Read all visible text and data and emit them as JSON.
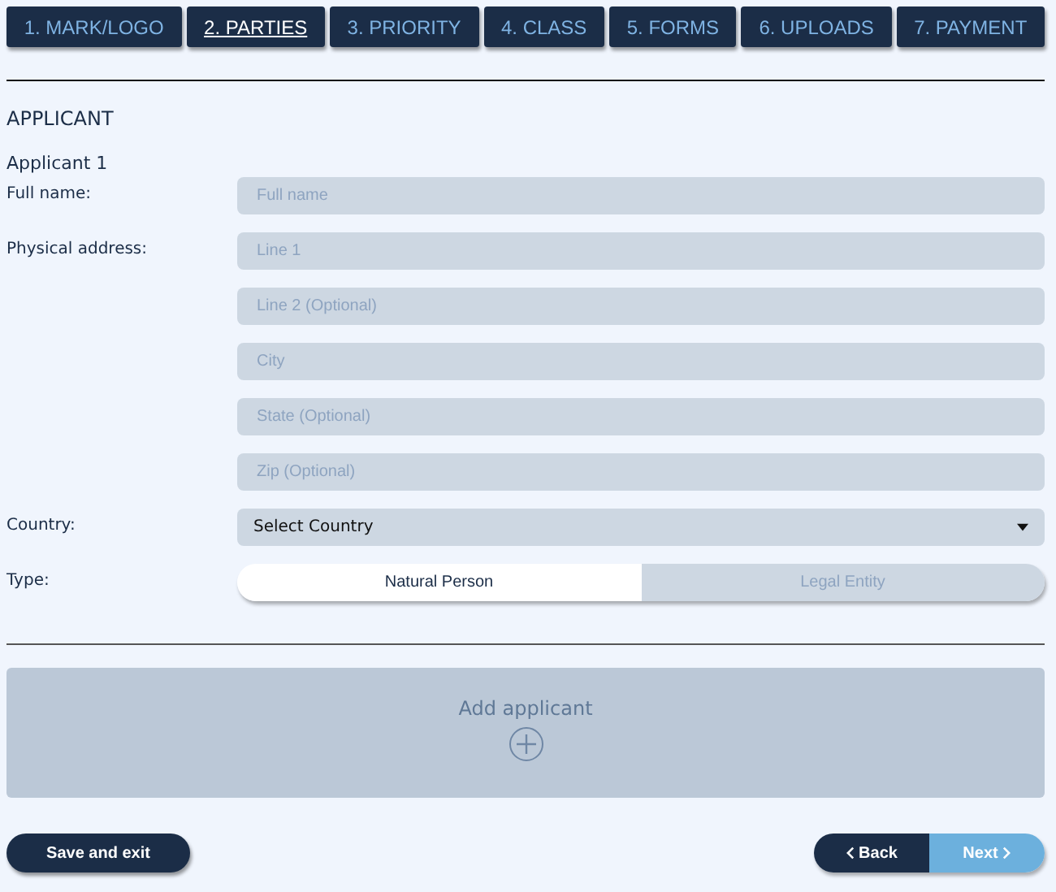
{
  "tabs": [
    {
      "label": "1. MARK/LOGO",
      "selected": false
    },
    {
      "label": "2. PARTIES",
      "selected": true
    },
    {
      "label": "3. PRIORITY",
      "selected": false
    },
    {
      "label": "4. CLASS",
      "selected": false
    },
    {
      "label": "5. FORMS",
      "selected": false
    },
    {
      "label": "6. UPLOADS",
      "selected": false
    },
    {
      "label": "7. PAYMENT",
      "selected": false
    }
  ],
  "section_title": "APPLICANT",
  "applicant_title": "Applicant 1",
  "fields": [
    {
      "label": "Full name:",
      "placeholder": "Full name"
    },
    {
      "label": "Physical address:",
      "placeholder": "Line 1"
    },
    {
      "placeholder": "Line 2 (Optional)"
    },
    {
      "placeholder": "City"
    },
    {
      "placeholder": "State (Optional)"
    },
    {
      "placeholder": "Zip (Optional)"
    }
  ],
  "country": {
    "label": "Country:",
    "value": "Select Country"
  },
  "type": {
    "label": "Type:",
    "options": [
      {
        "label": "Natural Person",
        "selected": true
      },
      {
        "label": "Legal Entity",
        "selected": false
      }
    ]
  },
  "add_applicant": "Add applicant",
  "buttons": [
    {
      "kind": "save",
      "label": "Save and exit"
    },
    {
      "kind": "back",
      "label": "Back"
    },
    {
      "kind": "next",
      "label": "Next"
    }
  ]
}
